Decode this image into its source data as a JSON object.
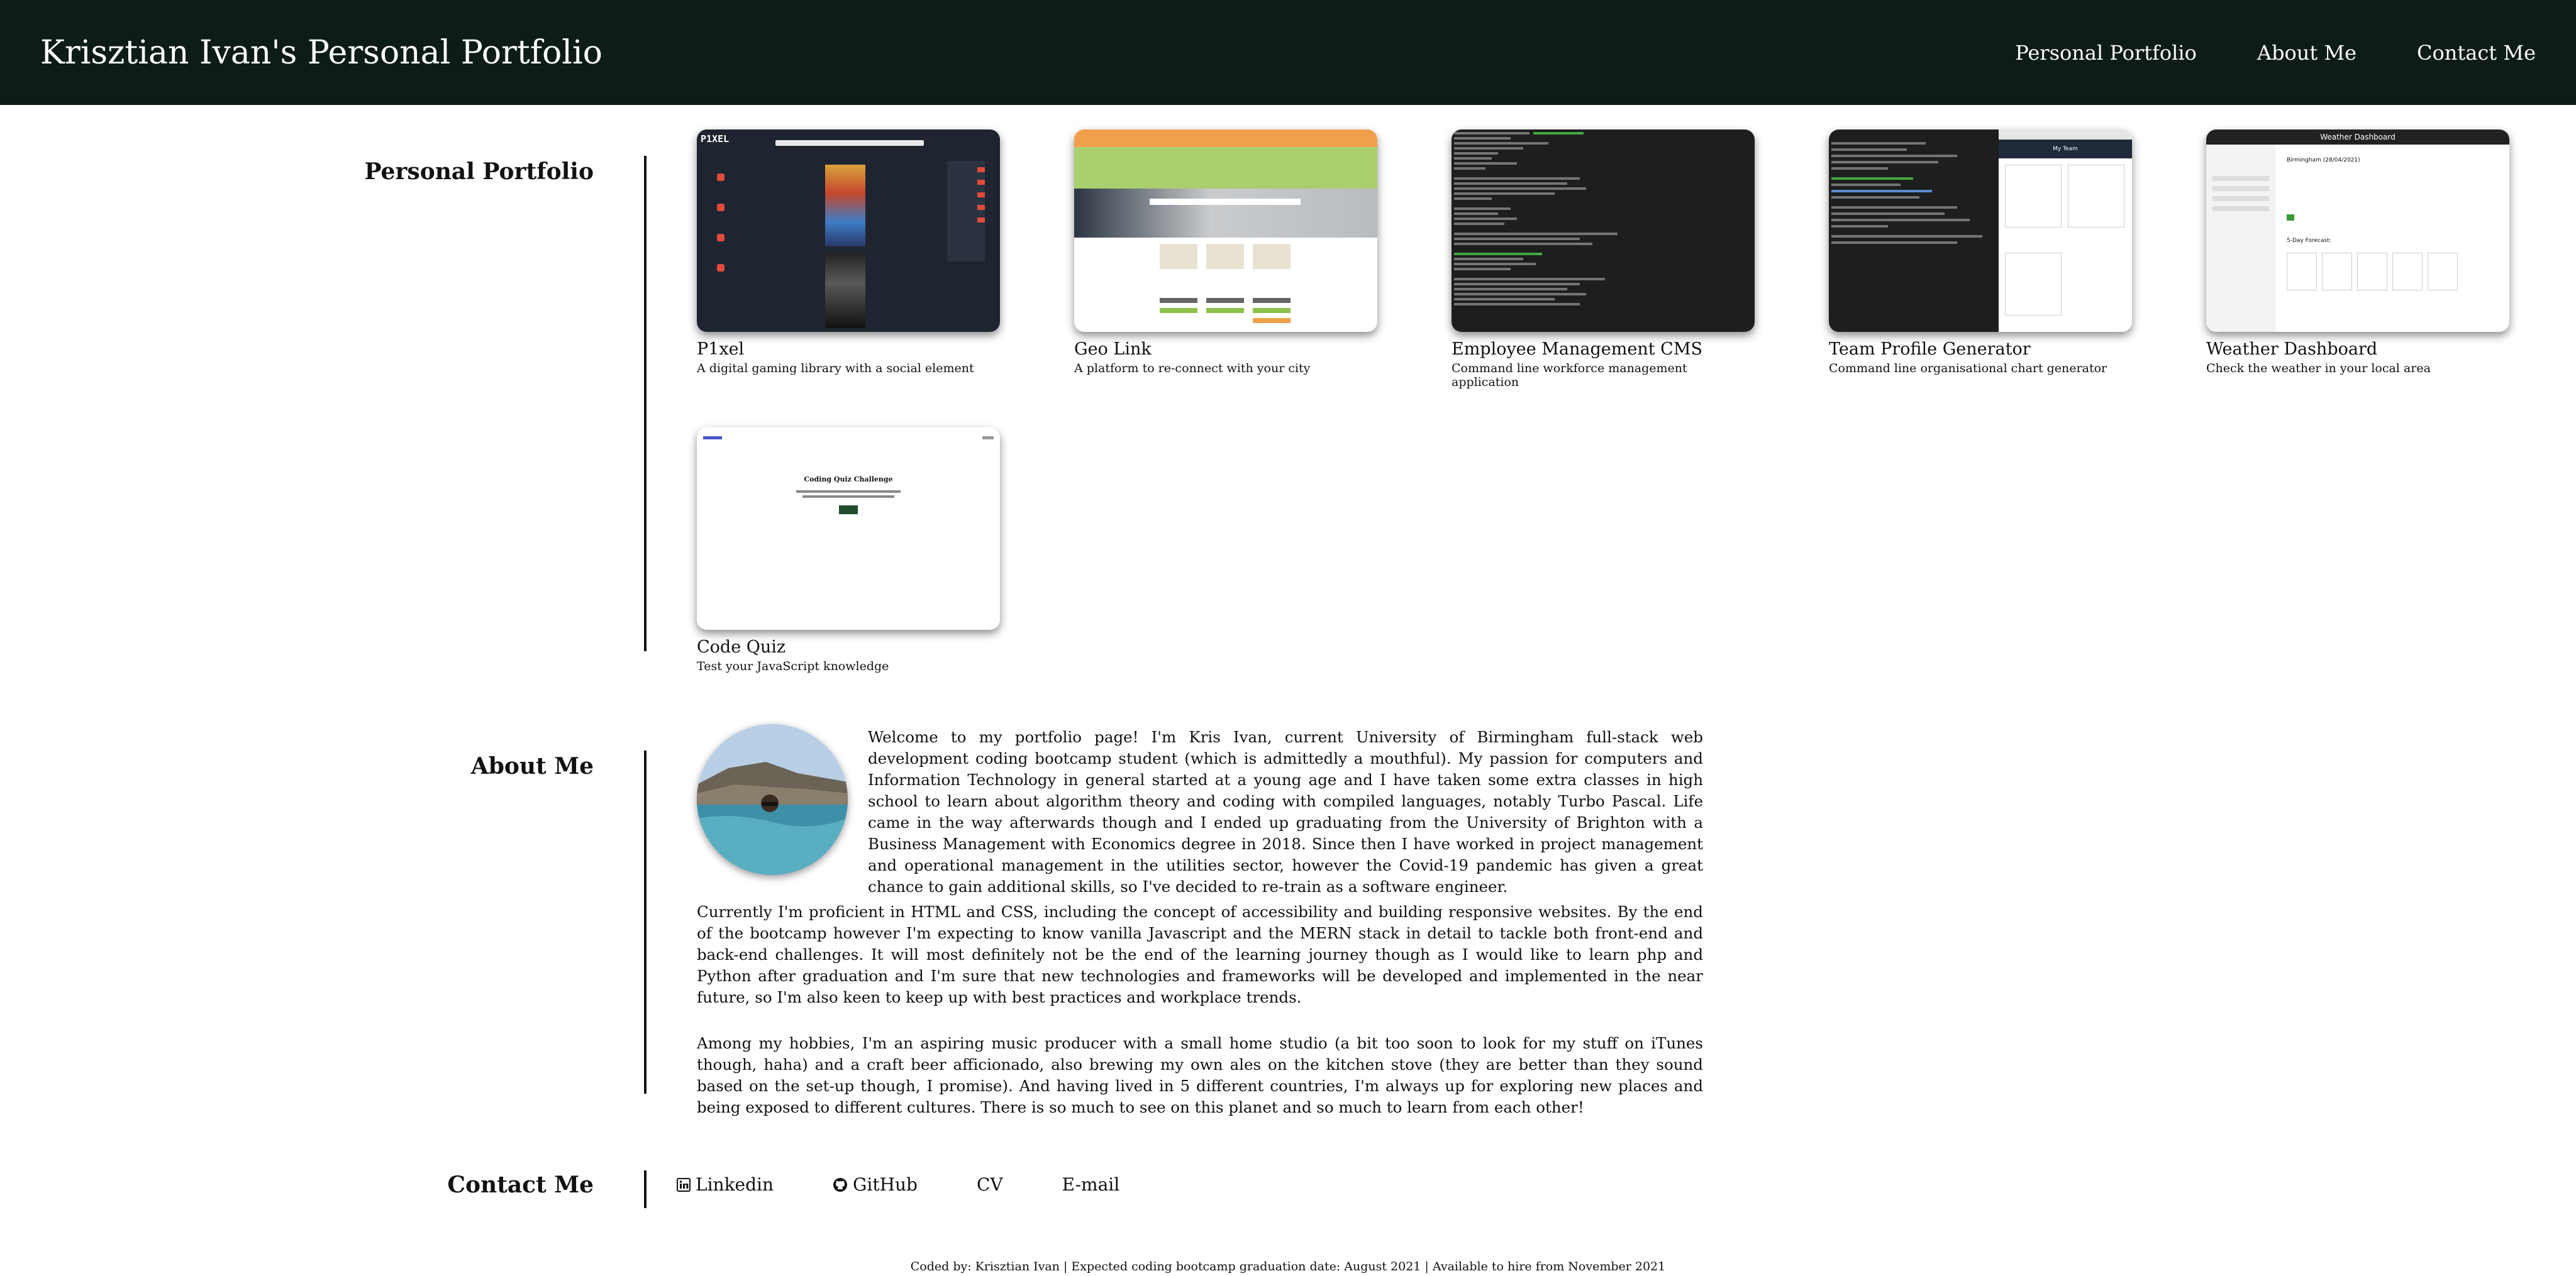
{
  "header": {
    "title": "Krisztian Ivan's Personal Portfolio",
    "nav": [
      "Personal Portfolio",
      "About Me",
      "Contact Me"
    ]
  },
  "portfolio": {
    "heading": "Personal Portfolio",
    "projects": [
      {
        "title": "P1xel",
        "desc": "A digital gaming library with a social element",
        "thumb_logo": "P1XEL"
      },
      {
        "title": "Geo Link",
        "desc": "A platform to re-connect with your city"
      },
      {
        "title": "Employee Management CMS",
        "desc": "Command line workforce management application"
      },
      {
        "title": "Team Profile Generator",
        "desc": "Command line organisational chart generator",
        "thumb_heading": "My Team"
      },
      {
        "title": "Weather Dashboard",
        "desc": "Check the weather in your local area",
        "thumb_heading": "Weather Dashboard",
        "thumb_city": "Birmingham (28/04/2021)",
        "thumb_forecast": "5-Day Forecast:"
      },
      {
        "title": "Code Quiz",
        "desc": "Test your JavaScript knowledge",
        "thumb_heading": "Coding Quiz Challenge"
      }
    ]
  },
  "about": {
    "heading": "About Me",
    "paragraphs": [
      "Welcome to my portfolio page! I'm Kris Ivan, current University of Birmingham full-stack web development coding bootcamp student (which is admittedly a mouthful). My passion for computers and Information Technology in general started at a young age and I have taken some extra classes in high school to learn about algorithm theory and coding with compiled languages, notably Turbo Pascal. Life came in the way afterwards though and I ended up graduating from the University of Brighton with a Business Management with Economics degree in 2018. Since then I have worked in project management and operational management in the utilities sector, however the Covid-19 pandemic has given a great chance to gain additional skills, so I've decided to re-train as a software engineer.",
      "Currently I'm proficient in HTML and CSS, including the concept of accessibility and building responsive websites. By the end of the bootcamp however I'm expecting to know vanilla Javascript and the MERN stack in detail to tackle both front-end and back-end challenges. It will most definitely not be the end of the learning journey though as I would like to learn php and Python after graduation and I'm sure that new technologies and frameworks will be developed and implemented in the near future, so I'm also keen to keep up with best practices and workplace trends.",
      "Among my hobbies, I'm an aspiring music producer with a small home studio (a bit too soon to look for my stuff on iTunes though, haha) and a craft beer afficionado, also brewing my own ales on the kitchen stove (they are better than they sound based on the set-up though, I promise). And having lived in 5 different countries, I'm always up for exploring new places and being exposed to different cultures. There is so much to see on this planet and so much to learn from each other!"
    ]
  },
  "contact": {
    "heading": "Contact Me",
    "links": [
      "Linkedin",
      "GitHub",
      "CV",
      "E-mail"
    ]
  },
  "footer": {
    "text": "Coded by: Krisztian Ivan | Expected coding bootcamp graduation date: August 2021 | Available to hire from November 2021"
  },
  "colors": {
    "header_bg": "#0e1c16",
    "quiz_button": "#1f4d2c",
    "geolink_header": "#f0a04b",
    "geolink_banner": "#a9cf6e"
  }
}
